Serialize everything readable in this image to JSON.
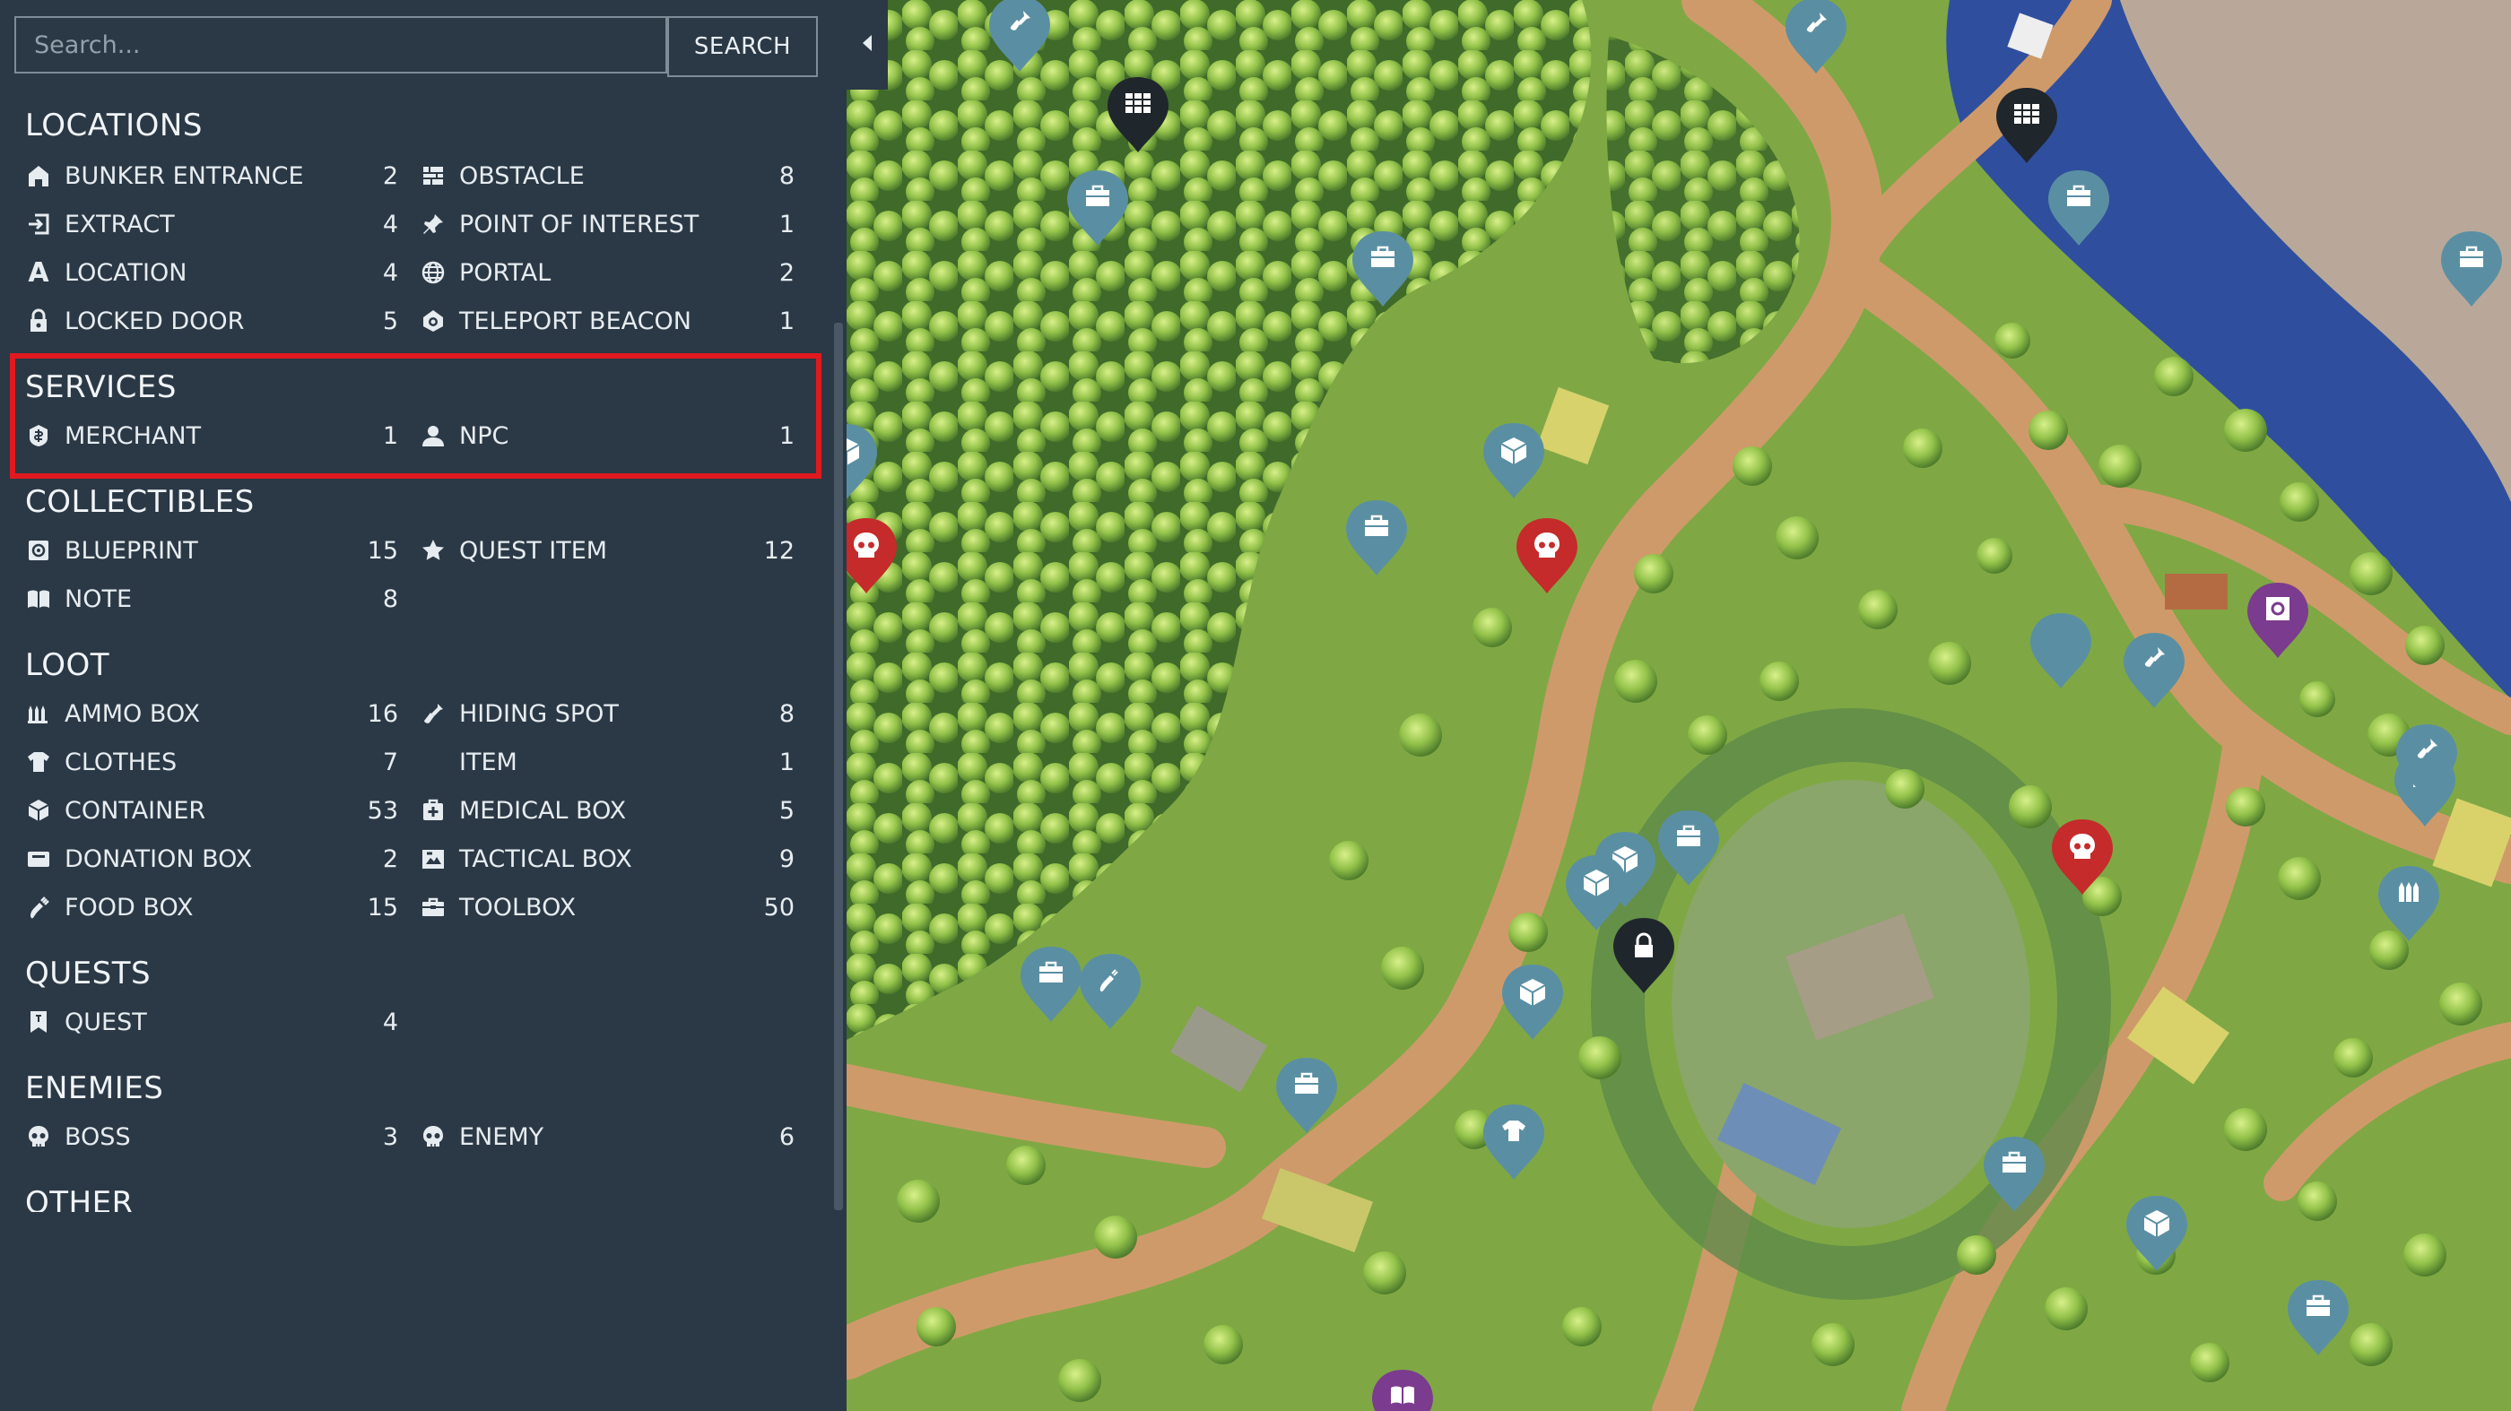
{
  "search": {
    "placeholder": "Search...",
    "button_label": "SEARCH"
  },
  "categories": {
    "locations": {
      "title": "LOCATIONS",
      "items": [
        {
          "label": "BUNKER ENTRANCE",
          "count": "2",
          "icon": "bunker-icon"
        },
        {
          "label": "OBSTACLE",
          "count": "8",
          "icon": "obstacle-icon"
        },
        {
          "label": "EXTRACT",
          "count": "4",
          "icon": "extract-icon"
        },
        {
          "label": "POINT OF INTEREST",
          "count": "1",
          "icon": "pin-icon"
        },
        {
          "label": "LOCATION",
          "count": "4",
          "icon": "letter-a-icon"
        },
        {
          "label": "PORTAL",
          "count": "2",
          "icon": "globe-icon"
        },
        {
          "label": "LOCKED DOOR",
          "count": "5",
          "icon": "lock-icon"
        },
        {
          "label": "TELEPORT BEACON",
          "count": "1",
          "icon": "beacon-icon"
        }
      ]
    },
    "services": {
      "title": "SERVICES",
      "items": [
        {
          "label": "MERCHANT",
          "count": "1",
          "icon": "merchant-icon"
        },
        {
          "label": "NPC",
          "count": "1",
          "icon": "person-icon"
        }
      ]
    },
    "collectibles": {
      "title": "COLLECTIBLES",
      "items": [
        {
          "label": "BLUEPRINT",
          "count": "15",
          "icon": "blueprint-icon"
        },
        {
          "label": "QUEST ITEM",
          "count": "12",
          "icon": "star-icon"
        },
        {
          "label": "NOTE",
          "count": "8",
          "icon": "note-icon"
        }
      ]
    },
    "loot": {
      "title": "LOOT",
      "items": [
        {
          "label": "AMMO BOX",
          "count": "16",
          "icon": "ammo-icon"
        },
        {
          "label": "HIDING SPOT",
          "count": "8",
          "icon": "shovel-icon"
        },
        {
          "label": "CLOTHES",
          "count": "7",
          "icon": "shirt-icon"
        },
        {
          "label": "ITEM",
          "count": "1",
          "icon": ""
        },
        {
          "label": "CONTAINER",
          "count": "53",
          "icon": "cube-icon"
        },
        {
          "label": "MEDICAL BOX",
          "count": "5",
          "icon": "medkit-icon"
        },
        {
          "label": "DONATION BOX",
          "count": "2",
          "icon": "donation-icon"
        },
        {
          "label": "TACTICAL BOX",
          "count": "9",
          "icon": "tactical-icon"
        },
        {
          "label": "FOOD BOX",
          "count": "15",
          "icon": "food-icon"
        },
        {
          "label": "TOOLBOX",
          "count": "50",
          "icon": "toolbox-icon"
        }
      ]
    },
    "quests": {
      "title": "QUESTS",
      "items": [
        {
          "label": "QUEST",
          "count": "4",
          "icon": "bookmark-icon"
        }
      ]
    },
    "enemies": {
      "title": "ENEMIES",
      "items": [
        {
          "label": "BOSS",
          "count": "3",
          "icon": "skull-icon"
        },
        {
          "label": "ENEMY",
          "count": "6",
          "icon": "skull-icon"
        }
      ]
    },
    "other": {
      "title": "OTHER"
    }
  },
  "colors": {
    "sidebar_bg": "#2b3845",
    "highlight": "#e0191f",
    "marker_blue": "#5a8fa3",
    "marker_red": "#c52b2b",
    "marker_dark": "#1f262c",
    "marker_purple": "#7b3b8e",
    "grass": "#7fa844",
    "path": "#cf9a6a",
    "water": "#2f4f9e"
  },
  "map": {
    "marker_icons": [
      "toolbox-icon",
      "cube-icon",
      "skull-icon",
      "lock-icon",
      "shovel-icon",
      "shirt-icon",
      "ammo-icon",
      "gate-icon",
      "gear-icon",
      "book-icon",
      "food-icon"
    ]
  }
}
